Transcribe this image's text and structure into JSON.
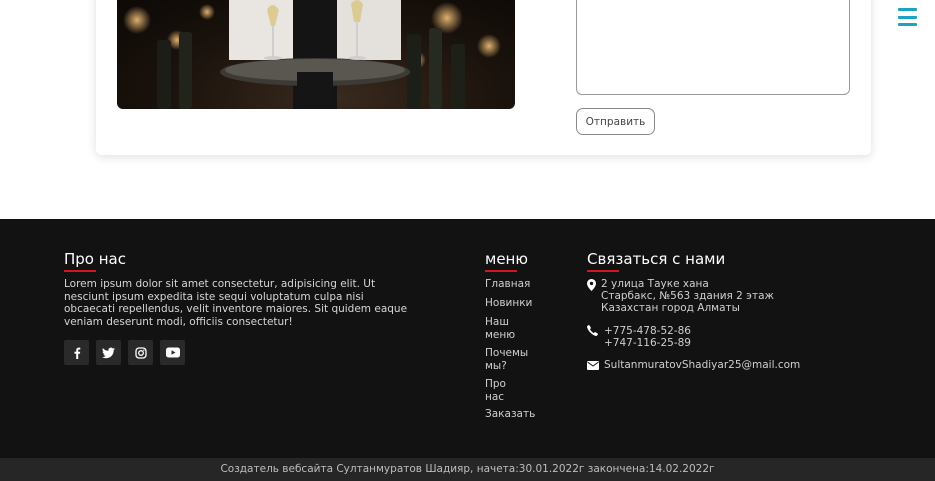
{
  "form": {
    "send_label": "Отправить"
  },
  "footer": {
    "about": {
      "title": "Про нас",
      "text": "Lorem ipsum dolor sit amet consectetur, adipisicing elit. Ut nesciunt ipsum expedita iste sequi voluptatum culpa nisi obcaecati repellendus, velit inventore maiores. Sit quidem eaque veniam deserunt modi, officiis consectetur!",
      "socials": [
        "facebook-icon",
        "twitter-icon",
        "instagram-icon",
        "youtube-icon"
      ]
    },
    "menu": {
      "title": "меню",
      "items": [
        "Главная",
        "Новинки",
        "Наш меню",
        "Почемы мы?",
        "Про нас",
        "Заказать"
      ]
    },
    "contact": {
      "title": "Связаться с нами",
      "address": [
        "2 улица Тауке хана",
        "Старбакс, №563 здания 2 этаж",
        "Казахстан город Алматы"
      ],
      "phones": [
        "+775-478-52-86",
        "+747-116-25-89"
      ],
      "email": "SultanmuratovShadiyar25@mail.com"
    },
    "copyright": "Создатель вебсайта Султанмуратов Шадияр, начета:30.01.2022г закончена:14.02.2022г"
  },
  "colors": {
    "accent_red": "#d4141e",
    "hamburger": "#1aa3c4",
    "footer_bg": "#121212"
  }
}
